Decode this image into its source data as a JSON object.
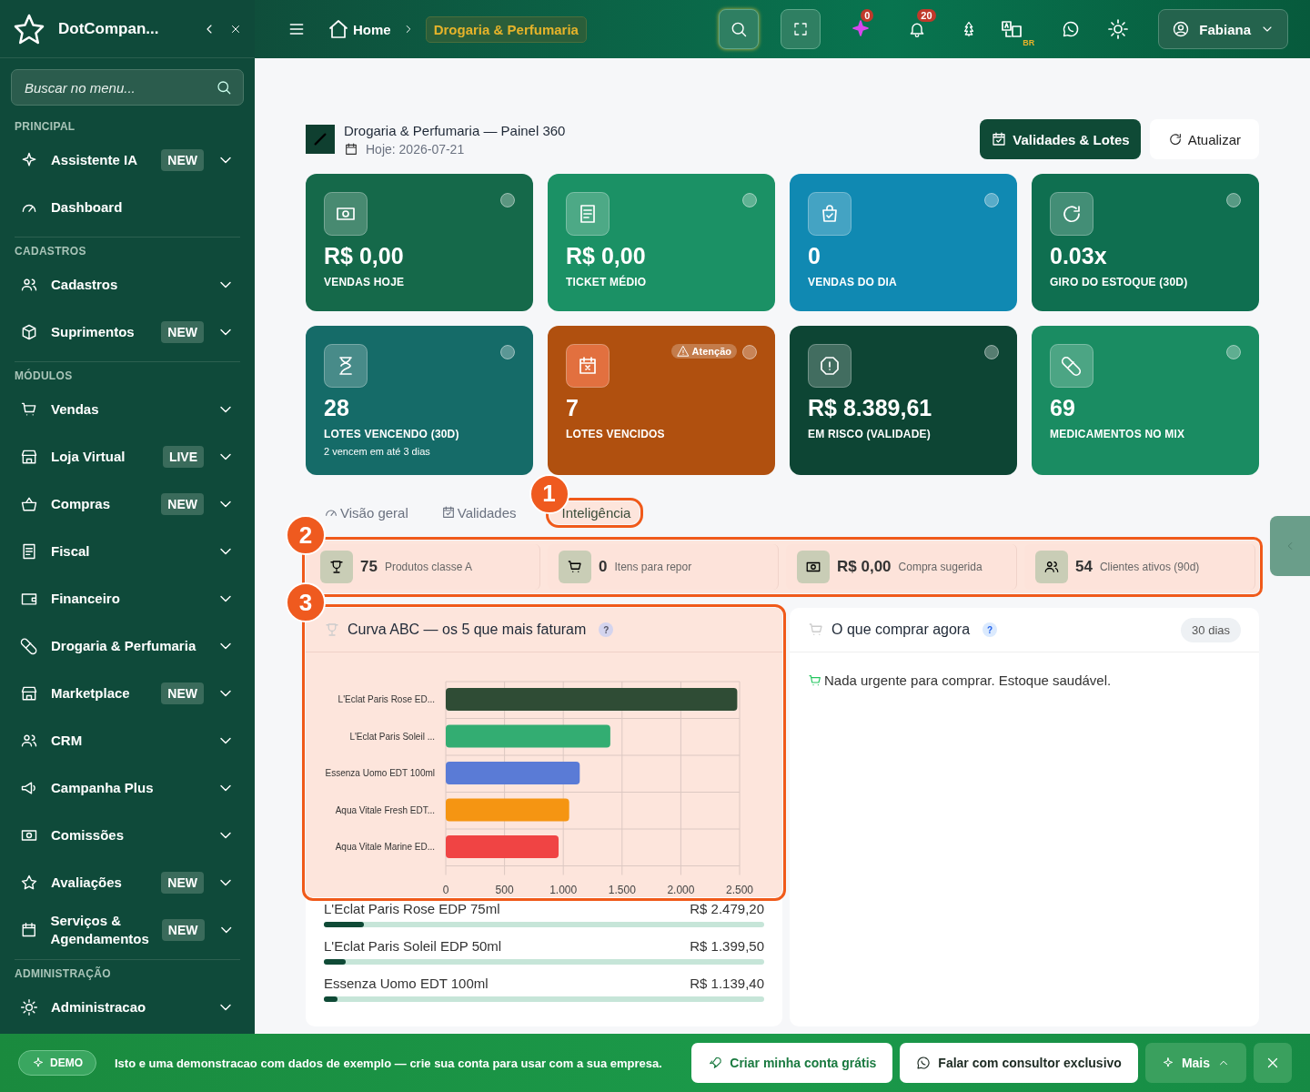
{
  "sidebar": {
    "brand": "DotCompan...",
    "search": {
      "placeholder": "Buscar no menu..."
    },
    "sections": [
      {
        "title": "PRINCIPAL",
        "items": [
          {
            "label": "Assistente IA",
            "badge": "NEW",
            "expanded": false
          },
          {
            "label": "Dashboard"
          }
        ]
      },
      {
        "title": "CADASTROS",
        "items": [
          {
            "label": "Cadastros",
            "expanded": false
          },
          {
            "label": "Suprimentos",
            "badge": "NEW",
            "expanded": false
          }
        ]
      },
      {
        "title": "MÓDULOS",
        "items": [
          {
            "label": "Vendas",
            "expanded": false
          },
          {
            "label": "Loja Virtual",
            "badge": "LIVE",
            "expanded": false
          },
          {
            "label": "Compras",
            "badge": "NEW",
            "expanded": false
          },
          {
            "label": "Fiscal",
            "expanded": false
          },
          {
            "label": "Financeiro",
            "expanded": false
          },
          {
            "label": "Drogaria & Perfumaria",
            "expanded": false
          },
          {
            "label": "Marketplace",
            "badge": "NEW",
            "expanded": false
          },
          {
            "label": "CRM",
            "expanded": false
          },
          {
            "label": "Campanha Plus",
            "expanded": false
          },
          {
            "label": "Comissões",
            "expanded": false
          },
          {
            "label": "Avaliações",
            "badge": "NEW",
            "expanded": false
          },
          {
            "label": "Serviços & Agendamentos",
            "badge": "NEW",
            "expanded": false
          }
        ]
      },
      {
        "title": "ADMINISTRAÇÃO",
        "items": [
          {
            "label": "Administracao",
            "expanded": false
          }
        ]
      }
    ]
  },
  "topbar": {
    "breadcrumb": [
      "Home",
      "Drogaria & Perfumaria"
    ],
    "ai_badge": "0",
    "notifications_badge": "20",
    "language": "BR",
    "user": "Fabiana"
  },
  "header": {
    "title": "Drogaria & Perfumaria — Painel 360",
    "date": "Hoje: 2026-07-21",
    "buttons": [
      "Validades & Lotes",
      "Atualizar"
    ]
  },
  "kpis": [
    {
      "value": "R$ 0,00",
      "label": "VENDAS HOJE",
      "color": "#15694a"
    },
    {
      "value": "R$ 0,00",
      "label": "TICKET MÉDIO",
      "color": "#1b9165"
    },
    {
      "value": "0",
      "label": "VENDAS DO DIA",
      "color": "#1089b2"
    },
    {
      "value": "0.03x",
      "label": "GIRO DO ESTOQUE (30D)",
      "color": "#0f6f50"
    },
    {
      "value": "28",
      "label": "LOTES VENCENDO (30D)",
      "note": "2 vencem em até 3 dias",
      "color": "#156b68"
    },
    {
      "value": "7",
      "label": "LOTES VENCIDOS",
      "warning": "Atenção",
      "color": "#b0500f"
    },
    {
      "value": "R$ 8.389,61",
      "label": "EM RISCO (VALIDADE)",
      "color": "#0d4534"
    },
    {
      "value": "69",
      "label": "MEDICAMENTOS NO MIX",
      "color": "#1a8c62"
    }
  ],
  "tabs": [
    {
      "label": "Visão geral",
      "selected": false
    },
    {
      "label": "Validades",
      "selected": false
    },
    {
      "label": "Inteligência",
      "selected": true,
      "tour_step": "1"
    }
  ],
  "stats": {
    "tour_step": "2",
    "items": [
      {
        "value": "75",
        "label": "Produtos classe A"
      },
      {
        "value": "0",
        "label": "Itens para repor"
      },
      {
        "value": "R$ 0,00",
        "label": "Compra sugerida"
      },
      {
        "value": "54",
        "label": "Clientes ativos (90d)"
      }
    ]
  },
  "abc": {
    "title": "Curva ABC — os 5 que mais faturam",
    "help": "?",
    "tour_step": "3",
    "chart_data": {
      "type": "bar",
      "orientation": "horizontal",
      "categories": [
        "L'Eclat Paris Rose ED...",
        "L'Eclat Paris Soleil ...",
        "Essenza Uomo EDT 100ml",
        "Aqua Vitale Fresh EDT...",
        "Aqua Vitale Marine ED..."
      ],
      "values": [
        2480,
        1400,
        1140,
        1050,
        960
      ],
      "grid": true,
      "xlim": [
        0,
        2500
      ],
      "xticks": [
        0,
        500,
        {
          "value": 1000,
          "label": "1.000"
        },
        {
          "value": 1500,
          "label": "1.500"
        },
        {
          "value": 2000,
          "label": "2.000"
        },
        {
          "value": 2500,
          "label": "2.500"
        }
      ]
    },
    "rows": [
      {
        "name": "L'Eclat Paris Rose EDP 75ml",
        "value": "R$ 2.479,20",
        "level": 0.09
      },
      {
        "name": "L'Eclat Paris Soleil EDP 50ml",
        "value": "R$ 1.399,50",
        "level": 0.05
      },
      {
        "name": "Essenza Uomo EDT 100ml",
        "value": "R$ 1.139,40",
        "level": 0.03
      }
    ]
  },
  "buy_now": {
    "title": "O que comprar agora",
    "help": "?",
    "period": "30 dias",
    "message": "Nada urgente para comprar. Estoque saudável."
  },
  "demo_bar": {
    "badge": "DEMO",
    "message": "Isto e uma **demonstracao** com dados de exemplo — crie sua conta para usar com a sua empresa.",
    "buttons": [
      "Criar minha conta grátis",
      "Falar com consultor exclusivo",
      "Mais"
    ]
  }
}
